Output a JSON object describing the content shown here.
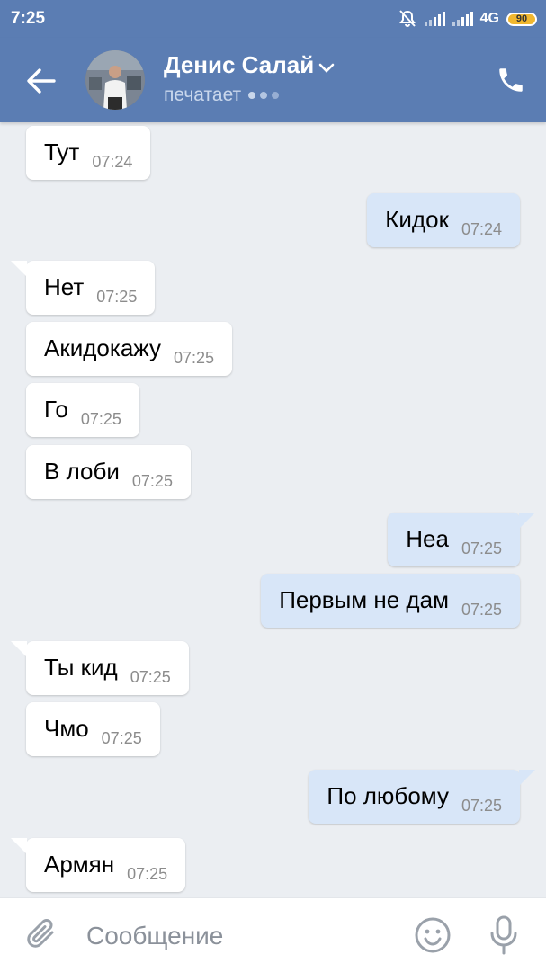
{
  "status_bar": {
    "time": "7:25",
    "network": "4G",
    "battery": "90"
  },
  "header": {
    "contact_name": "Денис Салай",
    "status": "печатает"
  },
  "messages": [
    {
      "dir": "in",
      "text": "Тут",
      "time": "07:24"
    },
    {
      "dir": "out",
      "text": "Кидок",
      "time": "07:24"
    },
    {
      "dir": "in",
      "text": "Нет",
      "time": "07:25"
    },
    {
      "dir": "in",
      "text": "Акидокажу",
      "time": "07:25"
    },
    {
      "dir": "in",
      "text": "Го",
      "time": "07:25"
    },
    {
      "dir": "in",
      "text": "В лоби",
      "time": "07:25"
    },
    {
      "dir": "out",
      "text": "Неа",
      "time": "07:25"
    },
    {
      "dir": "out",
      "text": "Первым не дам",
      "time": "07:25"
    },
    {
      "dir": "in",
      "text": "Ты кид",
      "time": "07:25"
    },
    {
      "dir": "in",
      "text": "Чмо",
      "time": "07:25"
    },
    {
      "dir": "out",
      "text": "По любому",
      "time": "07:25"
    },
    {
      "dir": "in",
      "text": "Армян",
      "time": "07:25"
    }
  ],
  "composer": {
    "placeholder": "Сообщение"
  },
  "colors": {
    "header": "#5b7db3",
    "incoming": "#ffffff",
    "outgoing": "#d8e6f8",
    "background": "#ebeef2"
  },
  "icons": {
    "back": "arrow-left-icon",
    "call": "phone-icon",
    "attach": "paperclip-icon",
    "emoji": "smile-icon",
    "voice": "mic-icon"
  }
}
